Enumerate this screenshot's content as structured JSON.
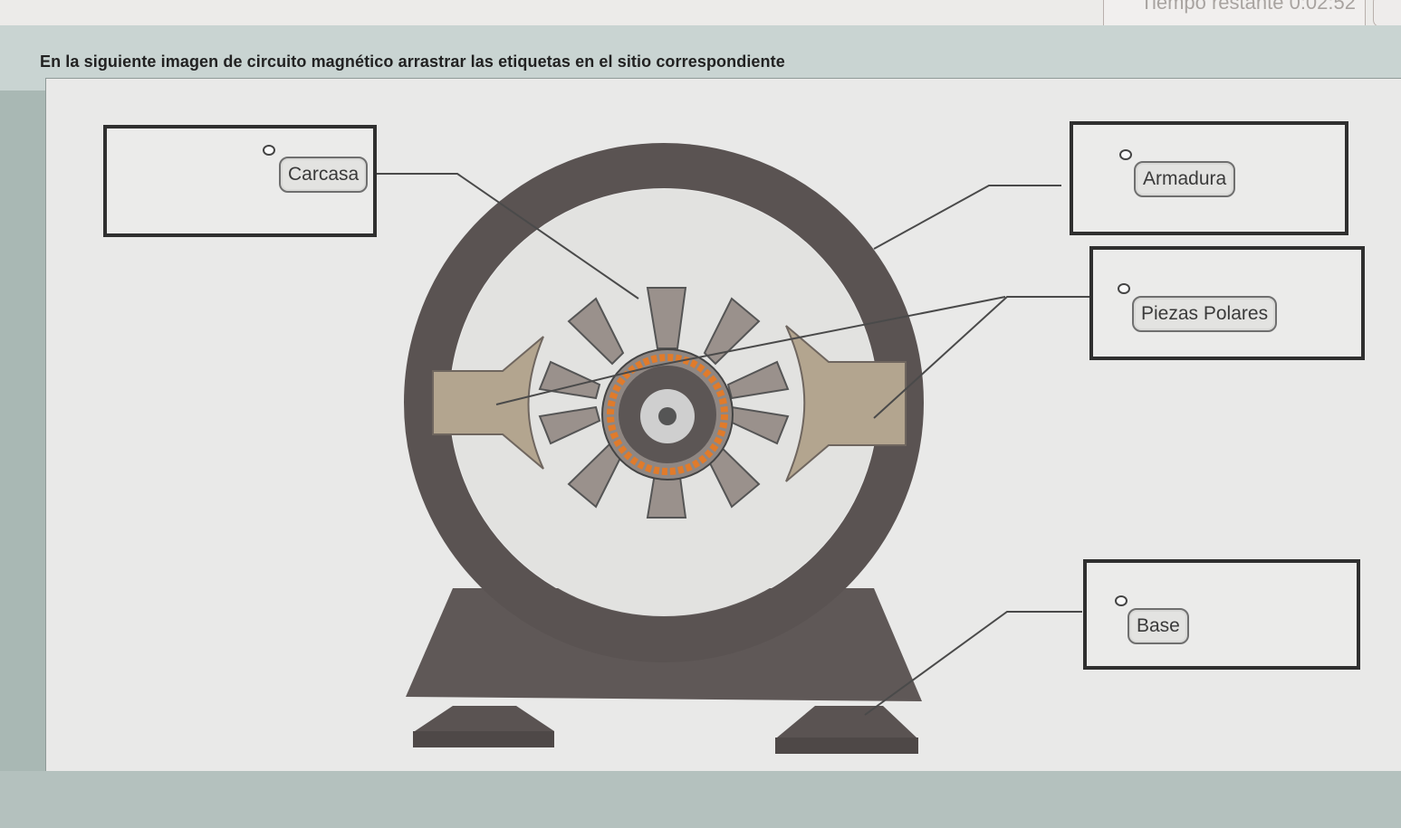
{
  "instruction": "En la siguiente imagen de circuito magnético arrastrar las etiquetas en el sitio correspondiente",
  "timer": {
    "text": "Tiempo restante 0:02:52"
  },
  "labels": {
    "carcasa": "Carcasa",
    "armadura": "Armadura",
    "piezas_polares": "Piezas Polares",
    "base": "Base"
  },
  "icons": {
    "drag_handle": "drag-handle-icon"
  },
  "colors": {
    "frame_ring": "#5a5352",
    "pole_shoe": "#b3a58f",
    "armature": "#8f8783",
    "winding": "#e07b2b",
    "base": "#5f5857"
  }
}
